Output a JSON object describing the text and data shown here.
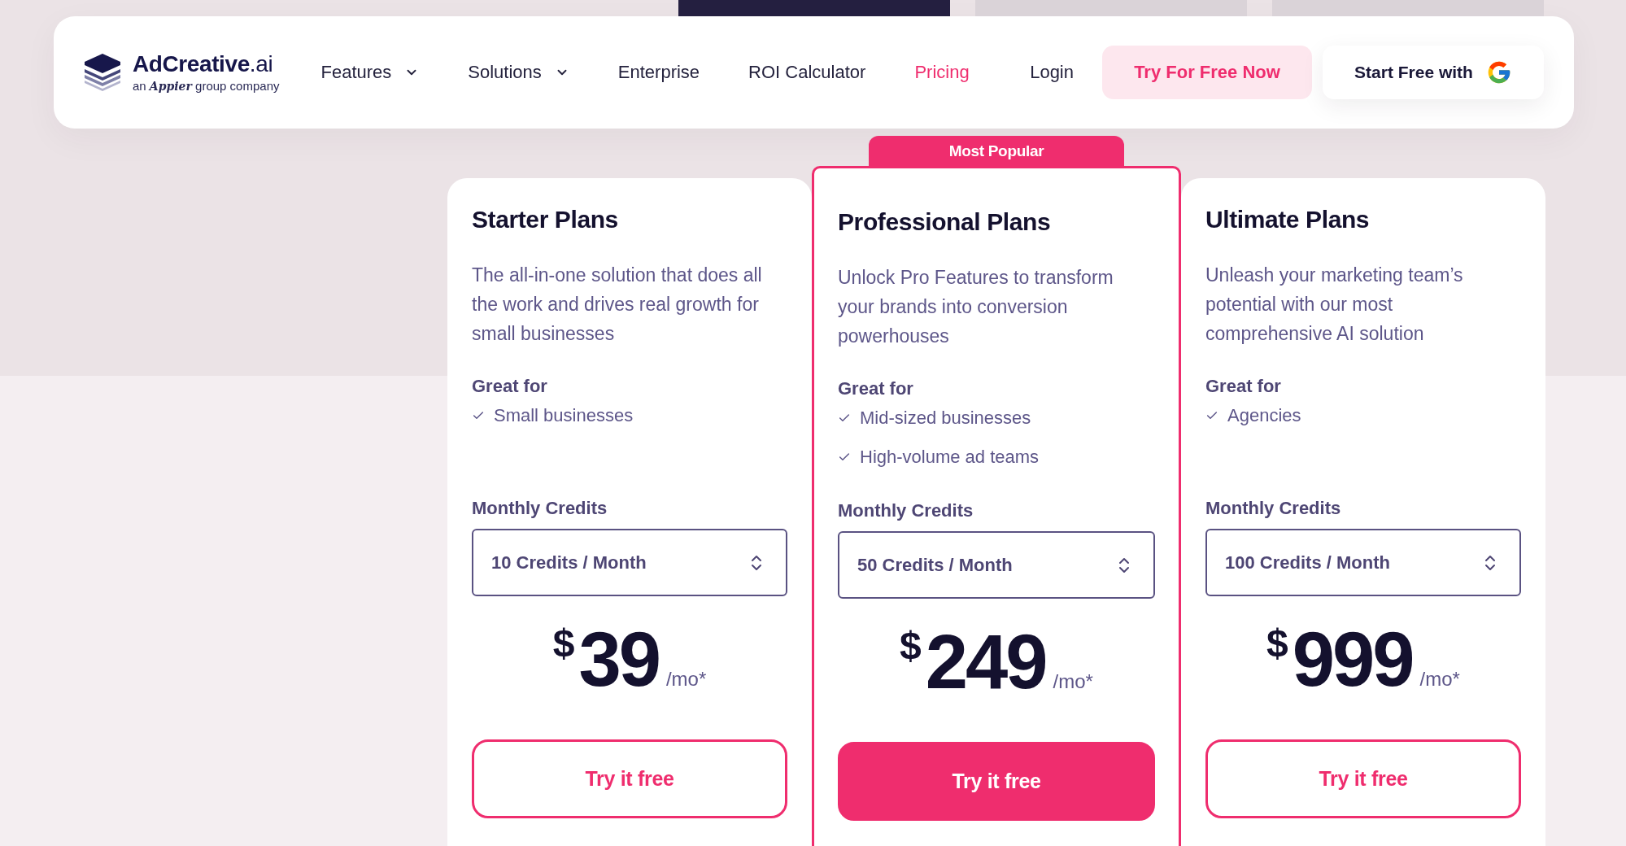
{
  "billing_toggle": [
    {
      "selected": true
    },
    {
      "selected": false
    },
    {
      "selected": false
    }
  ],
  "navbar": {
    "logo": {
      "wordmark": "**AdCreative**.ai",
      "tagline": "an **Appier** group company"
    },
    "links": [
      {
        "label": "Features",
        "dropdown": true,
        "selected": false
      },
      {
        "label": "Solutions",
        "dropdown": true,
        "selected": false
      },
      {
        "label": "Enterprise",
        "dropdown": false,
        "selected": false
      },
      {
        "label": "ROI Calculator",
        "dropdown": false,
        "selected": false
      },
      {
        "label": "Pricing",
        "dropdown": false,
        "selected": true
      }
    ],
    "login": "Login",
    "cta_button": "Try For Free Now",
    "google_button": "Start Free with"
  },
  "plans": [
    {
      "name": "Starter Plans",
      "featured": false,
      "description": "The all-in-one solution that does all the work and drives real growth for small businesses",
      "great_for_label": "Great for",
      "great_for": [
        "Small businesses"
      ],
      "credits_label": "Monthly Credits",
      "credits": "10 Credits / Month",
      "currency": "$",
      "price": "39",
      "period": "/mo*",
      "button": "Try it free"
    },
    {
      "name": "Professional Plans",
      "featured": true,
      "badge": "Most Popular",
      "description": "Unlock Pro Features to transform your brands into conversion powerhouses",
      "great_for_label": "Great for",
      "great_for": [
        "Mid-sized businesses",
        "High-volume ad teams"
      ],
      "credits_label": "Monthly Credits",
      "credits": "50 Credits / Month",
      "currency": "$",
      "price": "249",
      "period": "/mo*",
      "button": "Try it free"
    },
    {
      "name": "Ultimate Plans",
      "featured": false,
      "description": "Unleash your marketing team’s potential with our most comprehensive AI solution",
      "great_for_label": "Great for",
      "great_for": [
        "Agencies"
      ],
      "credits_label": "Monthly Credits",
      "credits": "100 Credits / Month",
      "currency": "$",
      "price": "999",
      "period": "/mo*",
      "button": "Try it free"
    }
  ]
}
